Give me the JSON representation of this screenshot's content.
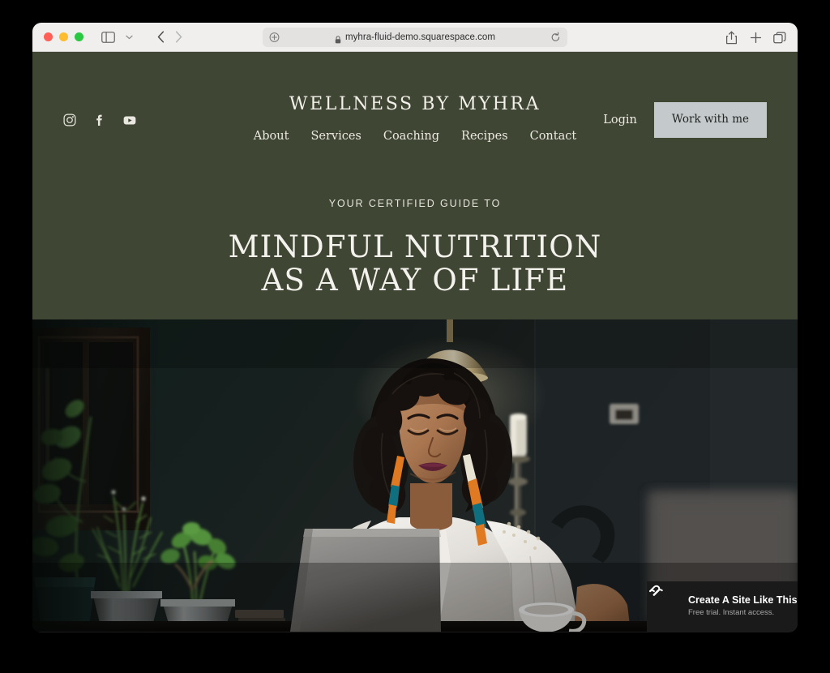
{
  "browser": {
    "traffic_lights": [
      "close",
      "minimize",
      "maximize"
    ],
    "url": "myhra-fluid-demo.squarespace.com",
    "url_secure": true,
    "back_label": "Back",
    "forward_label": "Forward",
    "sidebar_label": "Show Sidebar",
    "tab_overview_label": "Tab Overview",
    "new_tab_label": "New Tab",
    "share_label": "Share",
    "reload_label": "Reload"
  },
  "site": {
    "title": "WELLNESS BY MYHRA",
    "social": [
      {
        "name": "instagram-icon",
        "label": "Instagram"
      },
      {
        "name": "facebook-icon",
        "label": "Facebook"
      },
      {
        "name": "youtube-icon",
        "label": "YouTube"
      }
    ],
    "nav": [
      {
        "label": "About"
      },
      {
        "label": "Services"
      },
      {
        "label": "Coaching"
      },
      {
        "label": "Recipes"
      },
      {
        "label": "Contact"
      }
    ],
    "login_label": "Login",
    "cta_label": "Work with me",
    "colors": {
      "header_green": "#3f4634",
      "cta_background": "#c4c9cb",
      "cta_text": "#222521",
      "heading_text": "#f4f2ec",
      "badge_background": "#1a1a1a"
    }
  },
  "hero": {
    "eyebrow": "YOUR CERTIFIED GUIDE TO",
    "headline_line1": "MINDFUL NUTRITION",
    "headline_line2": "AS A WAY OF LIFE",
    "image_alt": "Woman with curly dark hair in a white blouse working at a laptop in a dark room with potted herbs and a brass lamp"
  },
  "badge": {
    "title": "Create A Site Like This",
    "subtitle": "Free trial. Instant access.",
    "logo_name": "squarespace-logo-icon"
  }
}
